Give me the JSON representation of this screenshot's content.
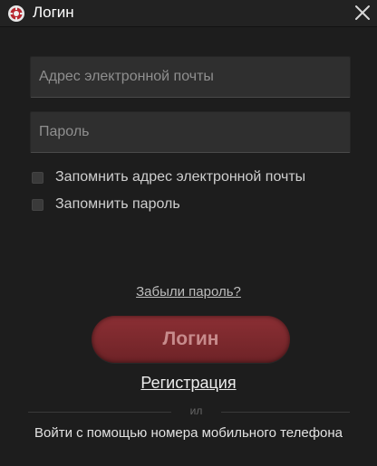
{
  "window": {
    "title": "Логин",
    "app_icon": "app-logo-icon",
    "close_icon": "close-icon"
  },
  "form": {
    "email_placeholder": "Адрес электронной почты",
    "email_value": "",
    "password_placeholder": "Пароль",
    "password_value": "",
    "remember_email_label": "Запомнить адрес электронной почты",
    "remember_email_checked": false,
    "remember_password_label": "Запомнить пароль",
    "remember_password_checked": false,
    "forgot_password": "Забыли пароль?",
    "login_button": "Логин",
    "register_link": "Регистрация",
    "or_text": "ил",
    "mobile_login": "Войти с помощью номера мобильного телефона"
  },
  "colors": {
    "background": "#1d1d1d",
    "input_background": "#2f2f2f",
    "login_button": "#7d2a2e",
    "login_text": "#c78b8c"
  }
}
